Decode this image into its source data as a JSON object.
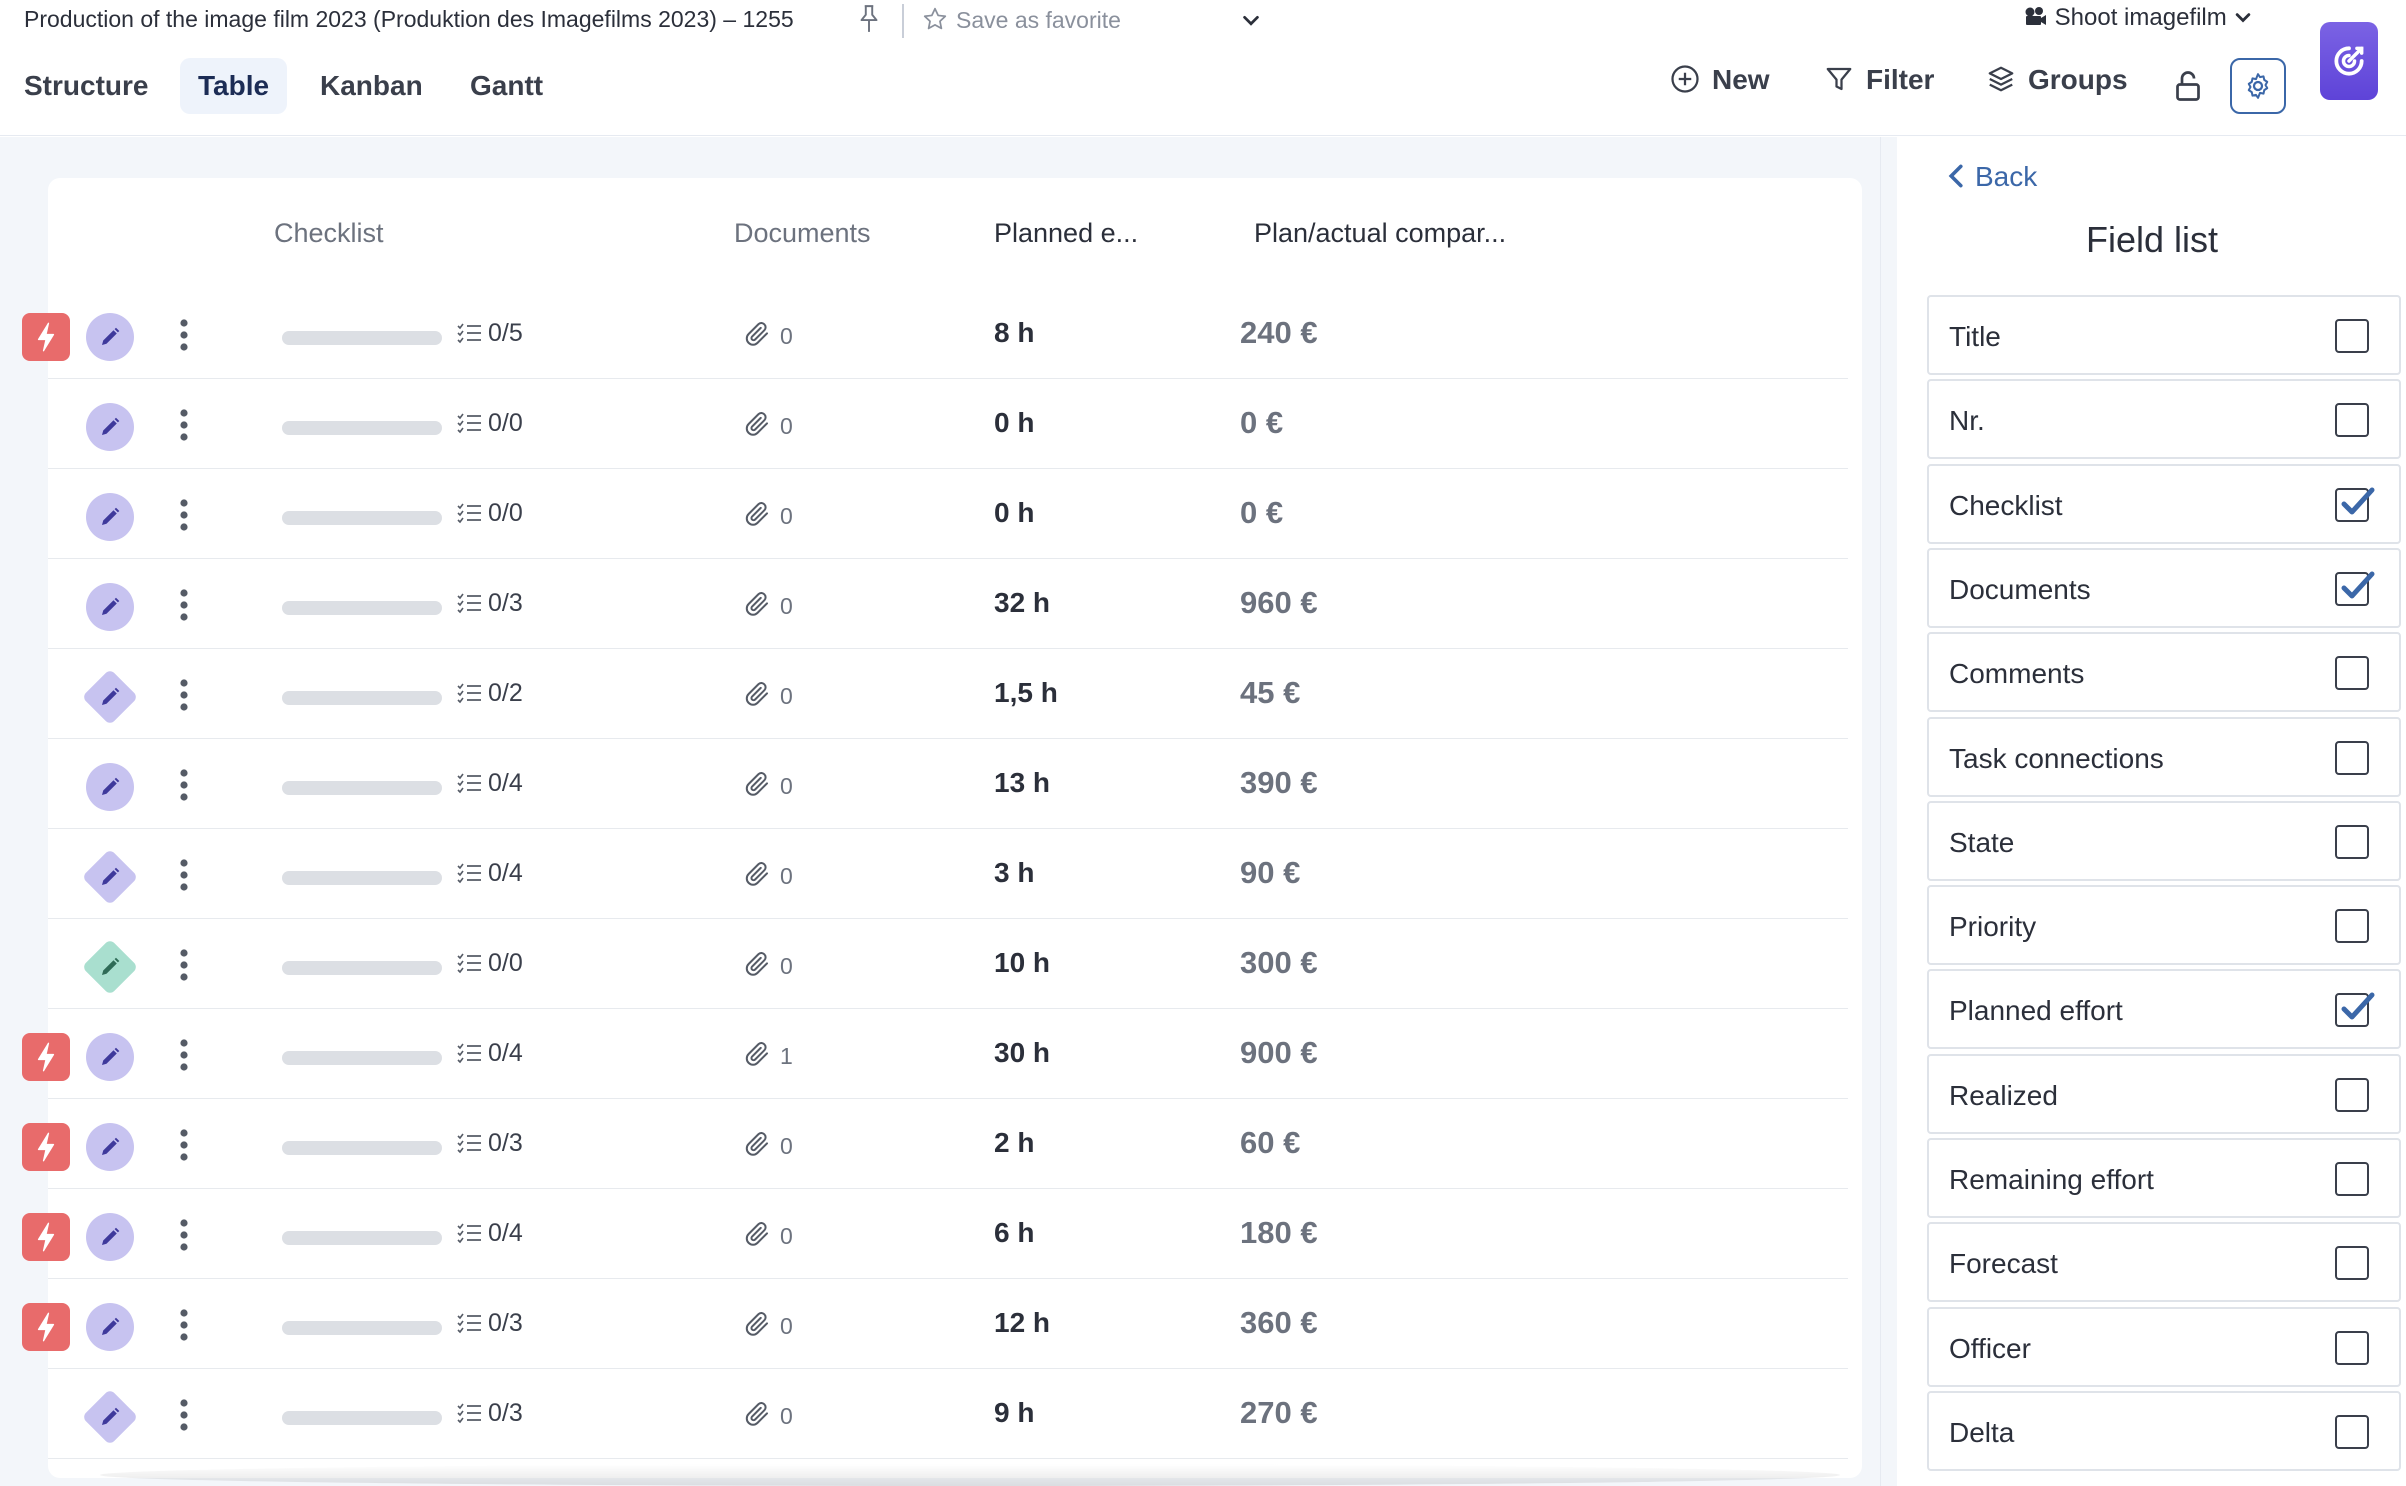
{
  "header": {
    "breadcrumb": "Production of the image film 2023 (Produktion des Imagefilms 2023) – 1255",
    "favorite_label": "Save as favorite",
    "project_label": "Shoot imagefilm"
  },
  "tabs": [
    {
      "label": "Structure",
      "active": false
    },
    {
      "label": "Table",
      "active": true
    },
    {
      "label": "Kanban",
      "active": false
    },
    {
      "label": "Gantt",
      "active": false
    }
  ],
  "actions": {
    "new": "New",
    "filter": "Filter",
    "groups": "Groups"
  },
  "table": {
    "columns": [
      "Checklist",
      "Documents",
      "Planned e...",
      "Plan/actual compar..."
    ],
    "rows": [
      {
        "priority": true,
        "type": "circle",
        "checklist": "0/5",
        "docs": "0",
        "planned": "8 h",
        "plan_actual": "240 €"
      },
      {
        "priority": false,
        "type": "circle",
        "checklist": "0/0",
        "docs": "0",
        "planned": "0 h",
        "plan_actual": "0 €"
      },
      {
        "priority": false,
        "type": "circle",
        "checklist": "0/0",
        "docs": "0",
        "planned": "0 h",
        "plan_actual": "0 €"
      },
      {
        "priority": false,
        "type": "circle",
        "checklist": "0/3",
        "docs": "0",
        "planned": "32 h",
        "plan_actual": "960 €"
      },
      {
        "priority": false,
        "type": "diamond",
        "checklist": "0/2",
        "docs": "0",
        "planned": "1,5 h",
        "plan_actual": "45 €"
      },
      {
        "priority": false,
        "type": "circle",
        "checklist": "0/4",
        "docs": "0",
        "planned": "13 h",
        "plan_actual": "390 €"
      },
      {
        "priority": false,
        "type": "diamond",
        "checklist": "0/4",
        "docs": "0",
        "planned": "3 h",
        "plan_actual": "90 €"
      },
      {
        "priority": false,
        "type": "diamond-green",
        "checklist": "0/0",
        "docs": "0",
        "planned": "10 h",
        "plan_actual": "300 €"
      },
      {
        "priority": true,
        "type": "circle",
        "checklist": "0/4",
        "docs": "1",
        "planned": "30 h",
        "plan_actual": "900 €"
      },
      {
        "priority": true,
        "type": "circle",
        "checklist": "0/3",
        "docs": "0",
        "planned": "2 h",
        "plan_actual": "60 €"
      },
      {
        "priority": true,
        "type": "circle",
        "checklist": "0/4",
        "docs": "0",
        "planned": "6 h",
        "plan_actual": "180 €"
      },
      {
        "priority": true,
        "type": "circle",
        "checklist": "0/3",
        "docs": "0",
        "planned": "12 h",
        "plan_actual": "360 €"
      },
      {
        "priority": false,
        "type": "diamond",
        "checklist": "0/3",
        "docs": "0",
        "planned": "9 h",
        "plan_actual": "270 €"
      }
    ]
  },
  "sidebar": {
    "back_label": "Back",
    "title": "Field list",
    "fields": [
      {
        "label": "Title",
        "checked": false
      },
      {
        "label": "Nr.",
        "checked": false
      },
      {
        "label": "Checklist",
        "checked": true
      },
      {
        "label": "Documents",
        "checked": true
      },
      {
        "label": "Comments",
        "checked": false
      },
      {
        "label": "Task connections",
        "checked": false
      },
      {
        "label": "State",
        "checked": false
      },
      {
        "label": "Priority",
        "checked": false
      },
      {
        "label": "Planned effort",
        "checked": true
      },
      {
        "label": "Realized",
        "checked": false
      },
      {
        "label": "Remaining effort",
        "checked": false
      },
      {
        "label": "Forecast",
        "checked": false
      },
      {
        "label": "Officer",
        "checked": false
      },
      {
        "label": "Delta",
        "checked": false
      }
    ]
  },
  "colors": {
    "accent": "#3b67a8",
    "priority_red": "#e86b6b",
    "task_purple": "#c7c3f0",
    "milestone_green": "#a9dfcf",
    "logo_purple": "#6a4fe0"
  }
}
